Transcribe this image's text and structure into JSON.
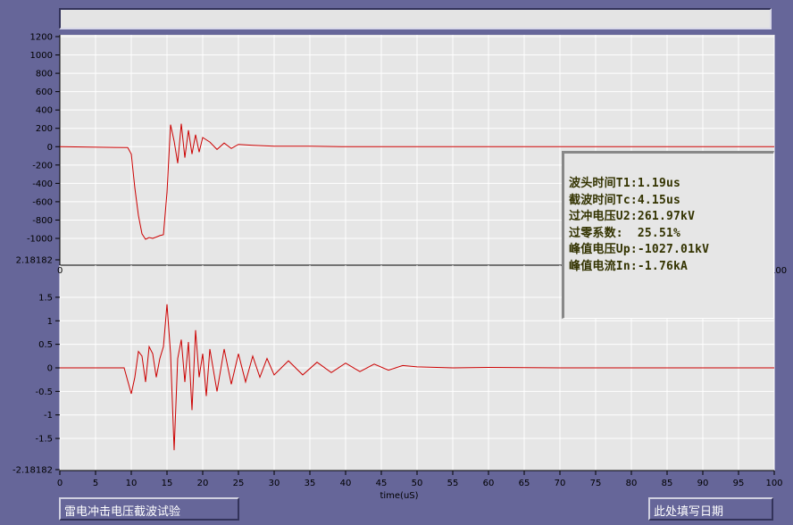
{
  "title_bar": {
    "text": ""
  },
  "chart_data": [
    {
      "type": "line",
      "title": "",
      "xlabel": "",
      "ylabel": "",
      "xlim": [
        0,
        100
      ],
      "ylim": [
        -1100,
        1200
      ],
      "yticks": [
        "1200",
        "1000",
        "800",
        "600",
        "400",
        "200",
        "0",
        "-200",
        "-400",
        "-600",
        "-800",
        "-1000"
      ],
      "color": "#cc0000",
      "series": [
        {
          "x": [
            0,
            9.5,
            10,
            10.5,
            11,
            11.5,
            12,
            12.5,
            13,
            13.5,
            14,
            14.5,
            15,
            15.5,
            16,
            16.5,
            17,
            17.5,
            18,
            18.5,
            19,
            19.5,
            20,
            21,
            22,
            23,
            24,
            25,
            27,
            30,
            35,
            40,
            50,
            60,
            70,
            80,
            90,
            100
          ],
          "values": [
            0,
            -10,
            -80,
            -450,
            -750,
            -950,
            -1010,
            -990,
            -1000,
            -985,
            -970,
            -960,
            -500,
            240,
            60,
            -180,
            250,
            -120,
            180,
            -80,
            130,
            -60,
            100,
            50,
            -30,
            40,
            -20,
            25,
            15,
            5,
            5,
            0,
            0,
            0,
            0,
            0,
            0,
            0
          ]
        }
      ]
    },
    {
      "type": "line",
      "title": "",
      "xlabel": "time(uS)",
      "ylabel": "",
      "xlim": [
        0,
        100
      ],
      "ylim": [
        -2.18182,
        2.18182
      ],
      "yticks": [
        "2.18182",
        "1.5",
        "1",
        "0.5",
        "0",
        "-0.5",
        "-1",
        "-1.5",
        "-2.18182"
      ],
      "xticks": [
        "0",
        "5",
        "10",
        "15",
        "20",
        "25",
        "30",
        "35",
        "40",
        "45",
        "50",
        "55",
        "60",
        "65",
        "70",
        "75",
        "80",
        "85",
        "90",
        "95",
        "100"
      ],
      "color": "#cc0000",
      "series": [
        {
          "x": [
            0,
            9,
            10,
            10.5,
            11,
            11.5,
            12,
            12.5,
            13,
            13.5,
            14,
            14.5,
            15,
            15.5,
            16,
            16.5,
            17,
            17.5,
            18,
            18.5,
            19,
            19.5,
            20,
            20.5,
            21,
            22,
            23,
            24,
            25,
            26,
            27,
            28,
            29,
            30,
            32,
            34,
            36,
            38,
            40,
            42,
            44,
            46,
            48,
            50,
            55,
            60,
            70,
            80,
            90,
            100
          ],
          "values": [
            0,
            0,
            -0.55,
            -0.2,
            0.35,
            0.25,
            -0.3,
            0.45,
            0.3,
            -0.2,
            0.2,
            0.45,
            1.35,
            0.3,
            -1.75,
            0.2,
            0.6,
            -0.3,
            0.55,
            -0.9,
            0.8,
            -0.2,
            0.3,
            -0.6,
            0.4,
            -0.5,
            0.4,
            -0.35,
            0.3,
            -0.3,
            0.25,
            -0.2,
            0.2,
            -0.15,
            0.15,
            -0.15,
            0.12,
            -0.1,
            0.1,
            -0.08,
            0.08,
            -0.05,
            0.05,
            0.02,
            0,
            0.01,
            0,
            0,
            0,
            0
          ]
        }
      ]
    }
  ],
  "info_panel": {
    "lines": [
      "波头时间T1:1.19us",
      "截波时间Tc:4.15us",
      "过冲电压U2:261.97kV",
      "过零系数:  25.51%",
      "峰值电压Up:-1027.01kV",
      "峰值电流In:-1.76kA"
    ]
  },
  "bottom": {
    "test_name": "雷电冲击电压截波试验",
    "date_placeholder": "此处填写日期"
  },
  "overlap_label": "2.18182",
  "top_chart_hidden_tick_left": "0",
  "top_chart_hidden_tick_right": "100"
}
